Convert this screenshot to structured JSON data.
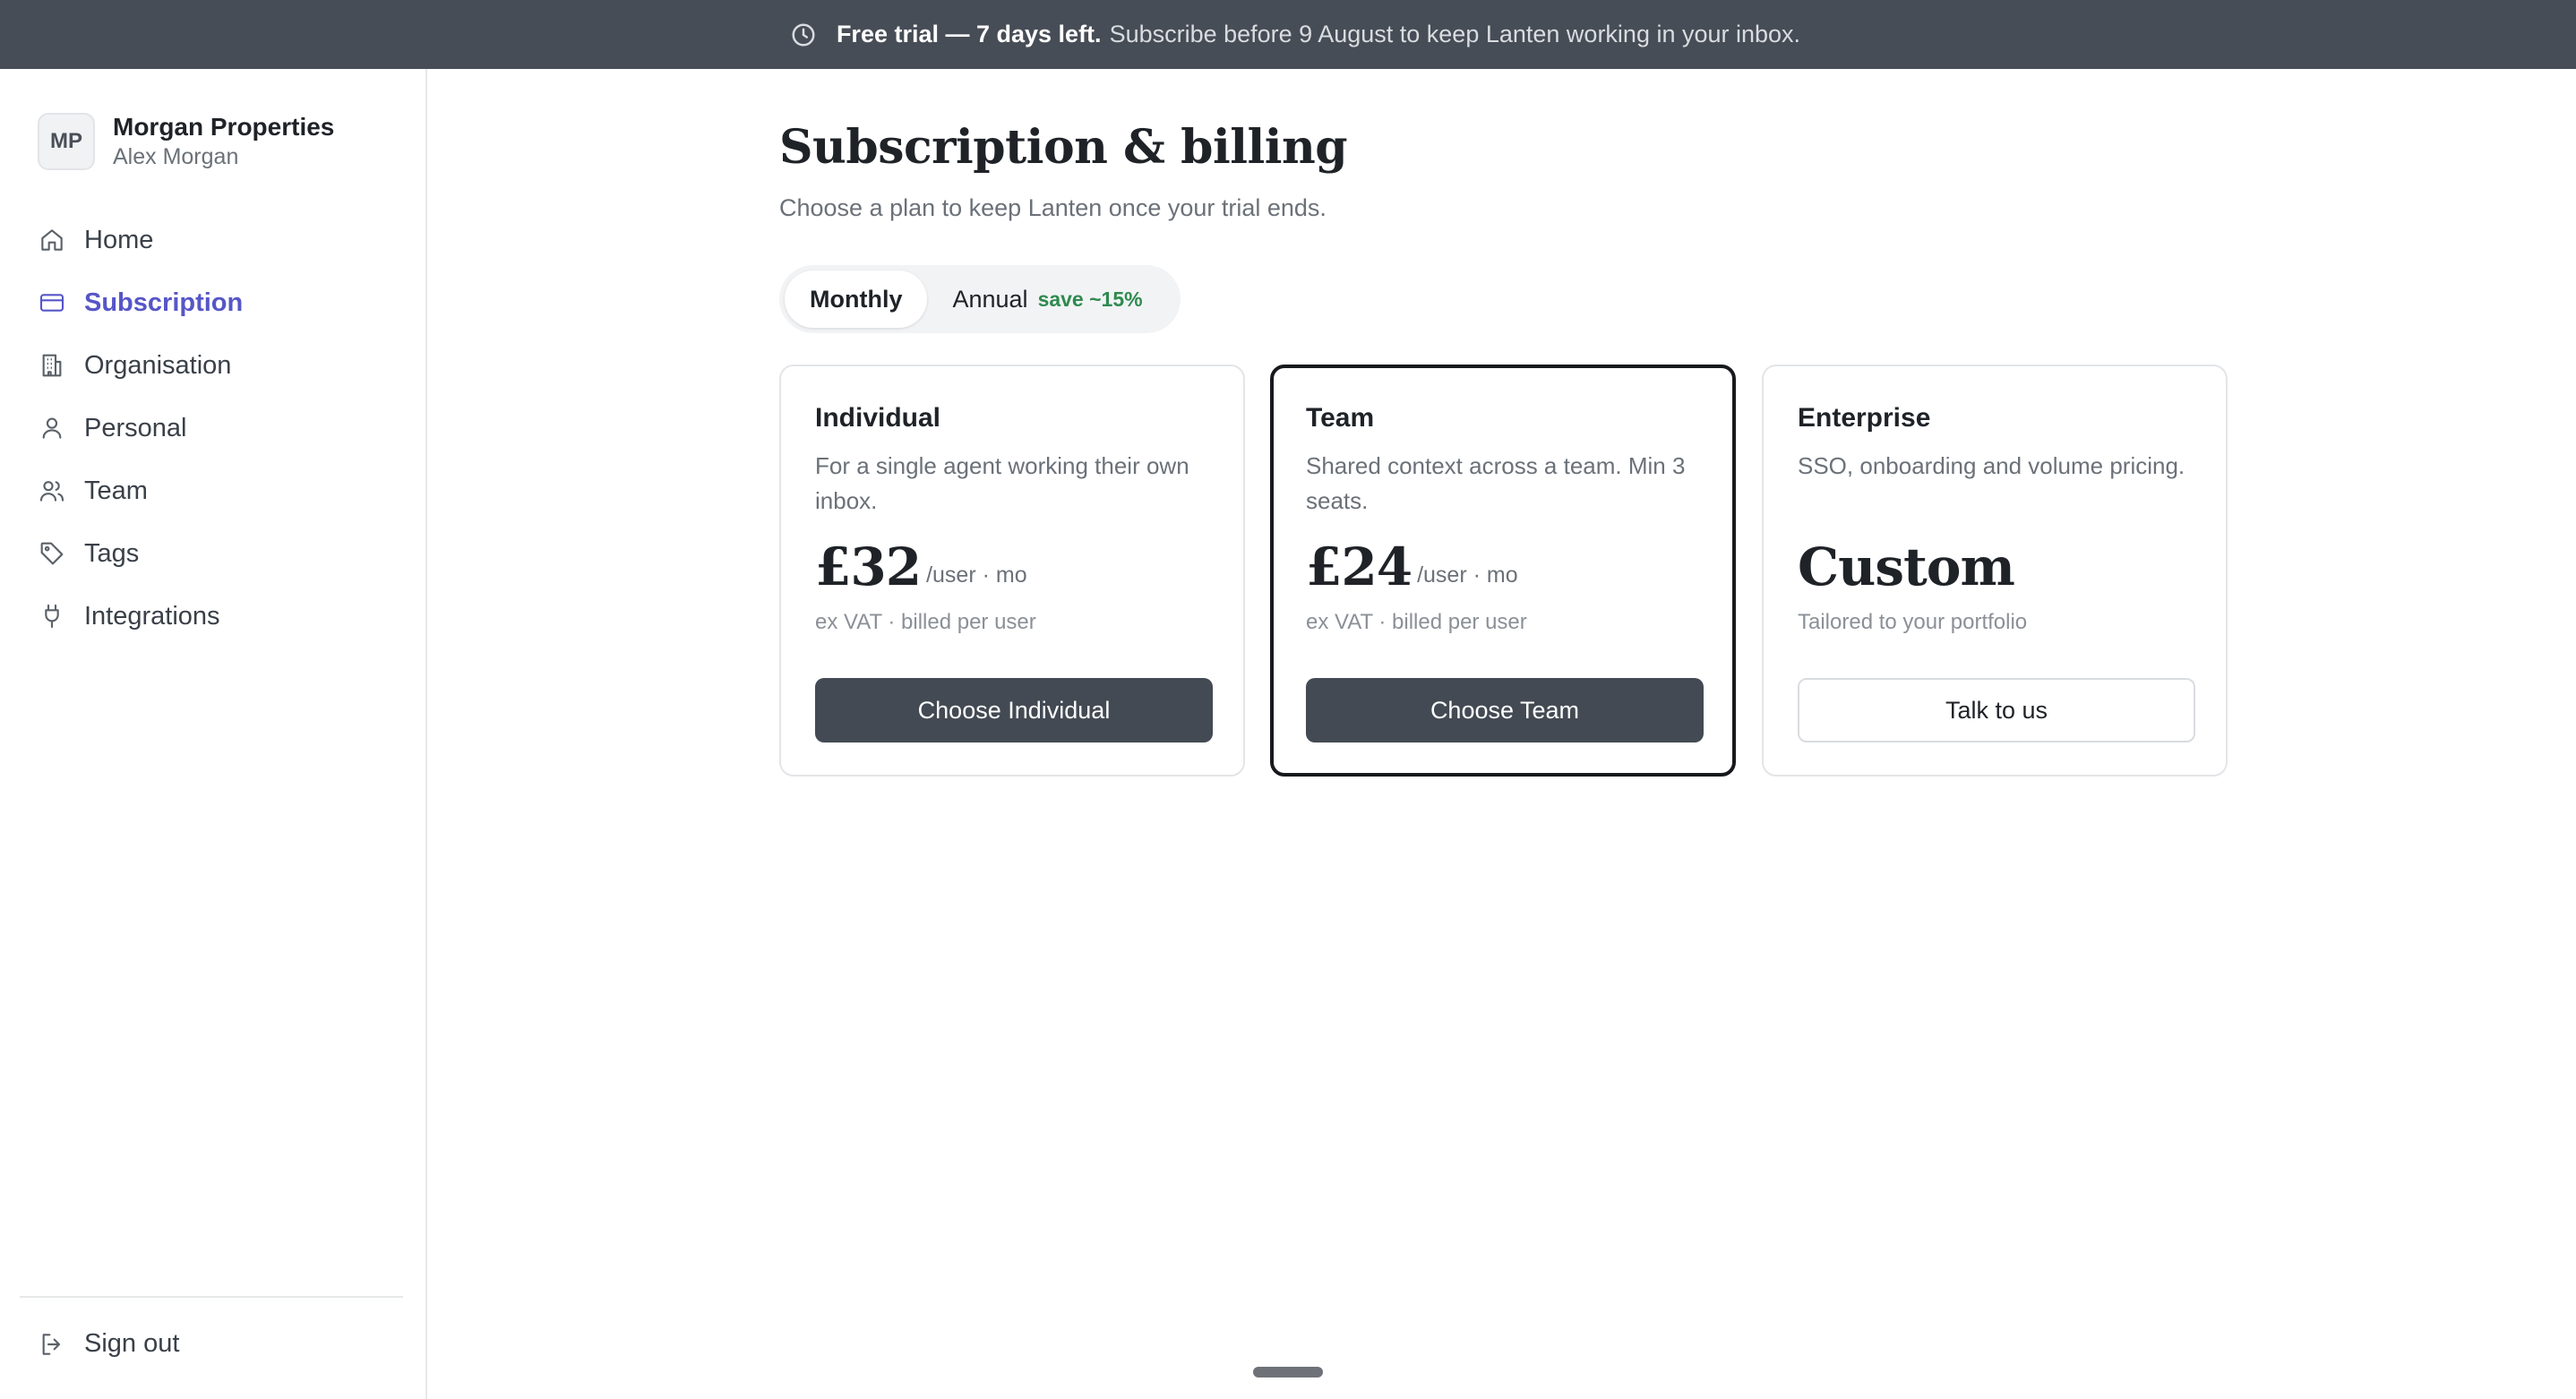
{
  "banner": {
    "icon": "clock-icon",
    "strong": "Free trial — 7 days left.",
    "text": "Subscribe before 9 August to keep Lanten working in your inbox."
  },
  "sidebar": {
    "org": {
      "initials": "MP",
      "name": "Morgan Properties",
      "user": "Alex Morgan"
    },
    "items": [
      {
        "label": "Home",
        "icon": "home-icon"
      },
      {
        "label": "Subscription",
        "icon": "credit-card-icon",
        "active": true
      },
      {
        "label": "Organisation",
        "icon": "building-icon"
      },
      {
        "label": "Personal",
        "icon": "user-icon"
      },
      {
        "label": "Team",
        "icon": "users-icon"
      },
      {
        "label": "Tags",
        "icon": "tag-icon"
      },
      {
        "label": "Integrations",
        "icon": "plug-icon"
      }
    ],
    "signout": {
      "label": "Sign out",
      "icon": "sign-out-icon"
    }
  },
  "main": {
    "title": "Subscription & billing",
    "subtitle": "Choose a plan to keep Lanten once your trial ends.",
    "billing_toggle": {
      "monthly": "Monthly",
      "annual": "Annual",
      "annual_badge": "save ~15%",
      "selected": "Monthly"
    },
    "plans": [
      {
        "name": "Individual",
        "description": "For a single agent working their own inbox.",
        "price": "£32",
        "unit": "/user · mo",
        "note": "ex VAT · billed per user",
        "cta": "Choose Individual"
      },
      {
        "name": "Team",
        "description": "Shared context across a team. Min 3 seats.",
        "price": "£24",
        "unit": "/user · mo",
        "note": "ex VAT · billed per user",
        "cta": "Choose Team",
        "highlighted": true
      },
      {
        "name": "Enterprise",
        "description": "SSO, onboarding and volume pricing.",
        "price": "Custom",
        "unit": "",
        "note": "Tailored to your portfolio",
        "cta": "Talk to us"
      }
    ]
  },
  "colors": {
    "banner_bg": "#474d56",
    "accent": "#5656c8",
    "button_dark": "#434a53",
    "save_green": "#2e8a4f"
  }
}
